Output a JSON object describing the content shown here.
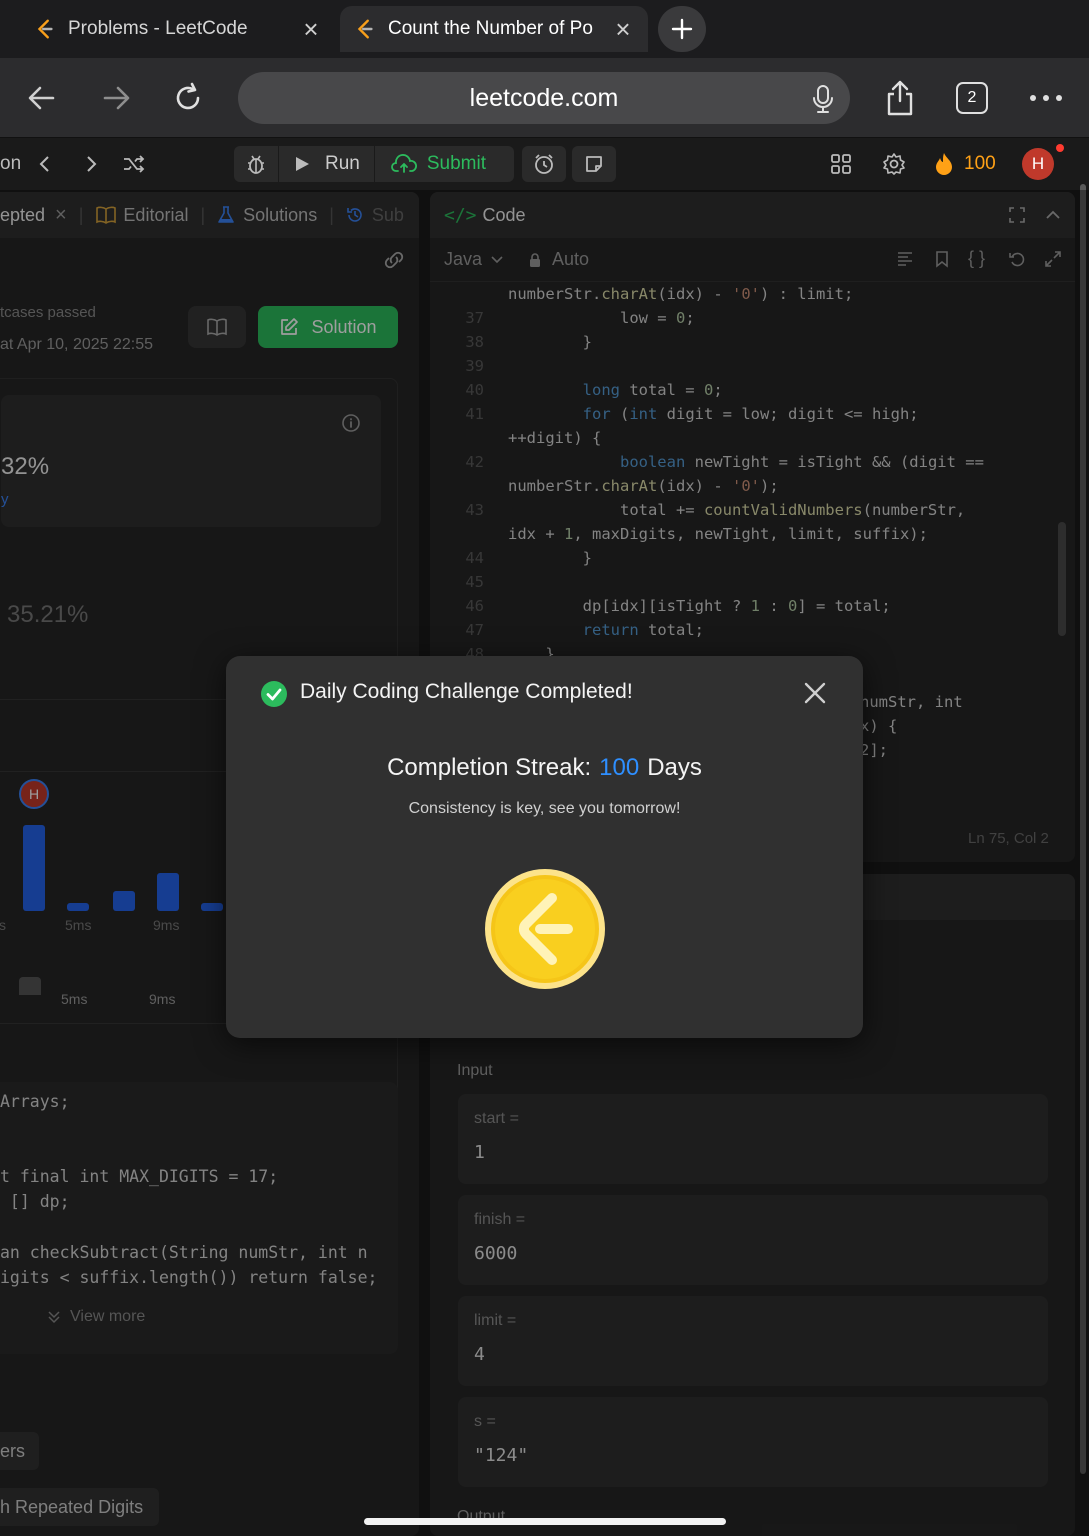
{
  "browser": {
    "tabs": [
      {
        "title": "Problems - LeetCode",
        "active": false
      },
      {
        "title": "Count the Number of Po",
        "active": true
      }
    ],
    "url": "leetcode.com",
    "tab_count": "2"
  },
  "lc_toolbar": {
    "left_text": "on",
    "run_label": "Run",
    "submit_label": "Submit",
    "streak_count": "100",
    "avatar_letter": "H"
  },
  "left_panel": {
    "tabs": [
      "epted",
      "Editorial",
      "Solutions",
      "Sub"
    ],
    "testcases_text": "tcases passed",
    "submitted_text": "at Apr 10, 2025 22:55",
    "solution_label": "Solution",
    "runtime_percent": "32%",
    "runtime_link": "y",
    "memory_percent": "35.21%",
    "chart_ticks": [
      "s",
      "5ms",
      "9ms"
    ],
    "chart_ticks2": [
      "5ms",
      "9ms"
    ],
    "avatar_letter": "H",
    "code_lines": [
      "Arrays;",
      "",
      "",
      "t final int MAX_DIGITS = 17;",
      " [] dp;",
      "",
      "an checkSubtract(String numStr, int n",
      "igits < suffix.length()) return false;"
    ],
    "view_more": "View more",
    "tag1": "ers",
    "tag2": "h Repeated Digits"
  },
  "code_panel": {
    "title": "Code",
    "language": "Java",
    "mode": "Auto",
    "status": "Ln 75, Col 2",
    "lines": [
      {
        "n": "",
        "t": "numberStr.charAt(idx) - '0') : limit;"
      },
      {
        "n": "37",
        "t": "            low = 0;"
      },
      {
        "n": "38",
        "t": "        }"
      },
      {
        "n": "39",
        "t": ""
      },
      {
        "n": "40",
        "t": "        long total = 0;"
      },
      {
        "n": "41",
        "t": "        for (int digit = low; digit <= high;"
      },
      {
        "n": "",
        "t": "++digit) {"
      },
      {
        "n": "42",
        "t": "            boolean newTight = isTight && (digit =="
      },
      {
        "n": "",
        "t": "numberStr.charAt(idx) - '0');"
      },
      {
        "n": "43",
        "t": "            total += countValidNumbers(numberStr,"
      },
      {
        "n": "",
        "t": "idx + 1, maxDigits, newTight, limit, suffix);"
      },
      {
        "n": "44",
        "t": "        }"
      },
      {
        "n": "45",
        "t": ""
      },
      {
        "n": "46",
        "t": "        dp[idx][isTight ? 1 : 0] = total;"
      },
      {
        "n": "47",
        "t": "        return total;"
      },
      {
        "n": "48",
        "t": "    }"
      }
    ],
    "peek_lines": [
      "numStr, int",
      "x) {",
      "2];"
    ]
  },
  "testcase_panel": {
    "input_label": "Input",
    "inputs": [
      {
        "label": "start =",
        "value": "1"
      },
      {
        "label": "finish =",
        "value": "6000"
      },
      {
        "label": "limit =",
        "value": "4"
      },
      {
        "label": "s =",
        "value": "\"124\""
      }
    ],
    "output_label": "Output"
  },
  "modal": {
    "title": "Daily Coding Challenge Completed!",
    "streak_prefix": "Completion Streak:",
    "streak_days": "100",
    "streak_suffix": "Days",
    "subtitle": "Consistency is key, see you tomorrow!"
  },
  "colors": {
    "accent_blue": "#2e8fff",
    "success_green": "#2cbb5d",
    "coin_yellow": "#f5c518",
    "streak_orange": "#ffa116"
  }
}
